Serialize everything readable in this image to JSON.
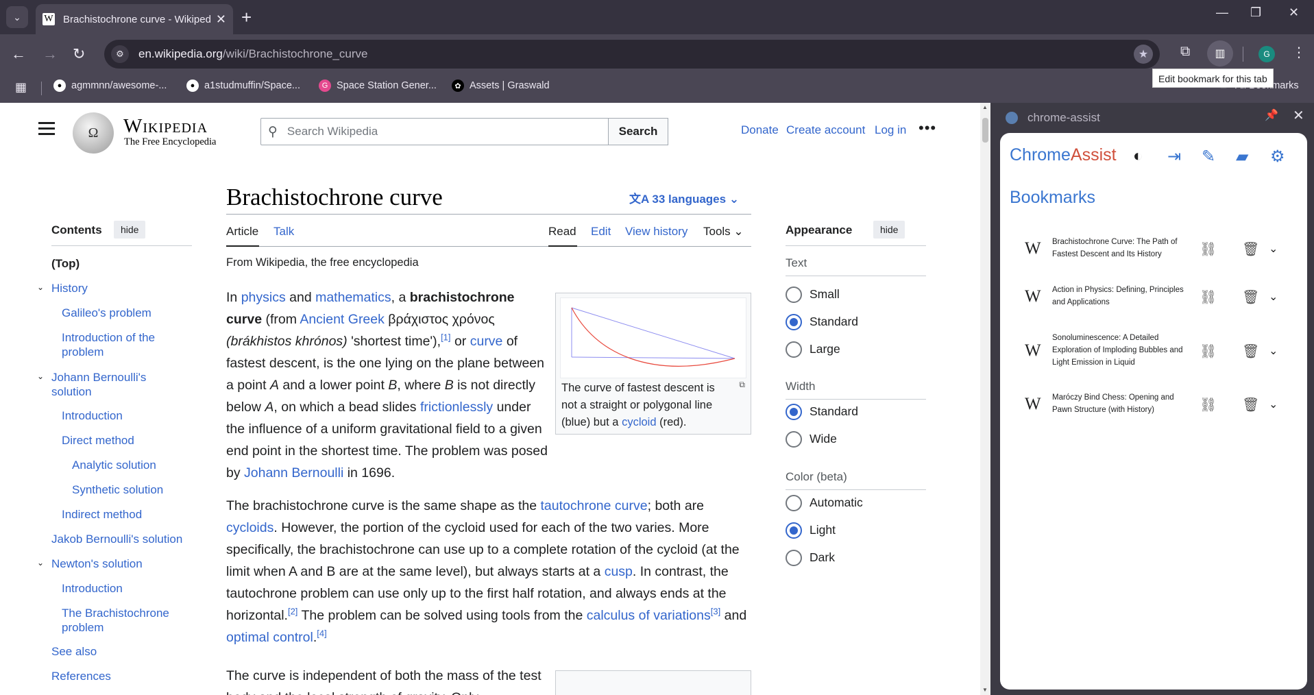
{
  "browser": {
    "tab_title": "Brachistochrone curve - Wikipedia",
    "tab_favicon": "W",
    "url_host": "en.wikipedia.org",
    "url_path": "/wiki/Brachistochrone_curve",
    "tooltip": "Edit bookmark for this tab",
    "profile_initial": "G",
    "bookmarks": [
      {
        "label": "agmmnn/awesome-...",
        "icon": "github-icon",
        "color": "#ffffff"
      },
      {
        "label": "a1studmuffin/Space...",
        "icon": "github-icon",
        "color": "#ffffff"
      },
      {
        "label": "Space Station Gener...",
        "icon": "g-icon",
        "color": "#e54a8f"
      },
      {
        "label": "Assets | Graswald",
        "icon": "graswald-icon",
        "color": "#ffffff"
      }
    ],
    "all_bookmarks": "All Bookmarks"
  },
  "wiki": {
    "wordmark": "Wikipedia",
    "tagline": "The Free Encyclopedia",
    "search_placeholder": "Search Wikipedia",
    "search_button": "Search",
    "user_links": [
      "Donate",
      "Create account",
      "Log in"
    ],
    "toc": {
      "title": "Contents",
      "hide": "hide",
      "items": [
        {
          "label": "(Top)",
          "level": 0,
          "bold": true,
          "caret": false
        },
        {
          "label": "History",
          "level": 0,
          "caret": true
        },
        {
          "label": "Galileo's problem",
          "level": 1
        },
        {
          "label": "Introduction of the problem",
          "level": 1
        },
        {
          "label": "Johann Bernoulli's solution",
          "level": 0,
          "caret": true
        },
        {
          "label": "Introduction",
          "level": 1
        },
        {
          "label": "Direct method",
          "level": 1
        },
        {
          "label": "Analytic solution",
          "level": 2
        },
        {
          "label": "Synthetic solution",
          "level": 2
        },
        {
          "label": "Indirect method",
          "level": 1
        },
        {
          "label": "Jakob Bernoulli's solution",
          "level": 0
        },
        {
          "label": "Newton's solution",
          "level": 0,
          "caret": true
        },
        {
          "label": "Introduction",
          "level": 1
        },
        {
          "label": "The Brachistochrone problem",
          "level": 1
        },
        {
          "label": "See also",
          "level": 0
        },
        {
          "label": "References",
          "level": 0
        }
      ]
    },
    "title": "Brachistochrone curve",
    "languages": "33 languages",
    "tabs": {
      "article": "Article",
      "talk": "Talk",
      "read": "Read",
      "edit": "Edit",
      "history": "View history",
      "tools": "Tools"
    },
    "from": "From Wikipedia, the free encyclopedia",
    "thumb_caption_pre": "The curve of fastest descent is not a straight or polygonal line (blue) but a ",
    "thumb_caption_link": "cycloid",
    "thumb_caption_post": " (red).",
    "appearance": {
      "title": "Appearance",
      "hide": "hide",
      "text_label": "Text",
      "text_options": [
        "Small",
        "Standard",
        "Large"
      ],
      "text_selected": "Standard",
      "width_label": "Width",
      "width_options": [
        "Standard",
        "Wide"
      ],
      "width_selected": "Standard",
      "color_label": "Color (beta)",
      "color_options": [
        "Automatic",
        "Light",
        "Dark"
      ],
      "color_selected": "Light"
    }
  },
  "panel": {
    "header": "chrome-assist",
    "app_name_a": "Chrome",
    "app_name_b": "Assist",
    "section": "Bookmarks",
    "items": [
      {
        "title": "Brachistochrone Curve: The Path of Fastest Descent and Its History"
      },
      {
        "title": "Action in Physics: Defining, Principles and Applications"
      },
      {
        "title": "Sonoluminescence: A Detailed Exploration of Imploding Bubbles and Light Emission in Liquid"
      },
      {
        "title": "Maróczy Bind Chess: Opening and Pawn Structure (with History)"
      }
    ]
  }
}
